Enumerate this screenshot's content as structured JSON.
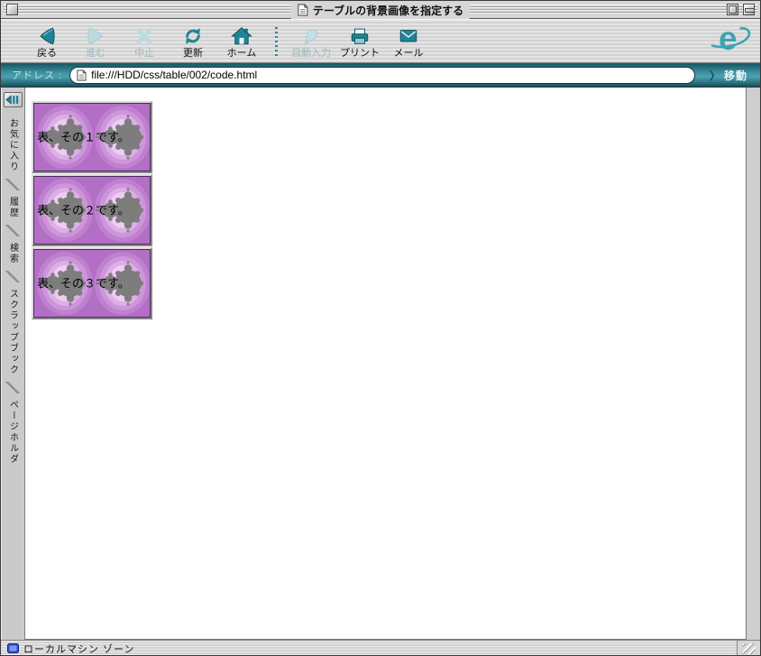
{
  "window": {
    "title": "テーブルの背景画像を指定する"
  },
  "toolbar": {
    "buttons": [
      {
        "label": "戻る",
        "enabled": true
      },
      {
        "label": "進む",
        "enabled": false
      },
      {
        "label": "中止",
        "enabled": false
      },
      {
        "label": "更新",
        "enabled": true
      },
      {
        "label": "ホーム",
        "enabled": true
      },
      {
        "label": "自動入力",
        "enabled": false
      },
      {
        "label": "プリント",
        "enabled": true
      },
      {
        "label": "メール",
        "enabled": true
      }
    ],
    "logo_letter": "e"
  },
  "addressbar": {
    "label": "アドレス :",
    "url": "file:///HDD/css/table/002/code.html",
    "go_arrow": "〉",
    "go_label": "移動"
  },
  "sidebar": {
    "tabs": [
      {
        "label": "お気に入り"
      },
      {
        "label": "履歴"
      },
      {
        "label": "検索"
      },
      {
        "label": "スクラップブック"
      },
      {
        "label": "ページホルダ"
      }
    ]
  },
  "content": {
    "tables": [
      {
        "label": "表、その１です。"
      },
      {
        "label": "表、その２です。"
      },
      {
        "label": "表、その３です。"
      }
    ]
  },
  "statusbar": {
    "zone_label": "ローカルマシン ゾーン"
  },
  "colors": {
    "teal_icon": "#1f8495",
    "teal_disabled": "#bcdbe0",
    "address_bar_teal": "#3f93a3",
    "table_purple": "#b26fc5",
    "fractal_gray": "#7d7d7d",
    "zone_icon_blue": "#2b50d8"
  }
}
